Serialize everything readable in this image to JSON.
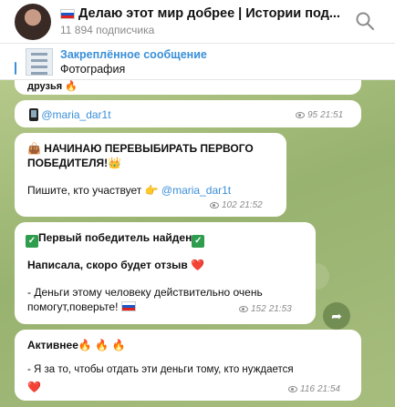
{
  "header": {
    "title": "Делаю этот мир добрее | Истории под...",
    "subscribers": "11 894 подписчика",
    "search_icon": "search-icon"
  },
  "pinned": {
    "label": "Закреплённое сообщение",
    "text": "Фотография"
  },
  "messages": {
    "top_fragment": "друзья 🔥",
    "m1": {
      "link": "@maria_dar1t",
      "views": "95",
      "time": "21:51"
    },
    "m2": {
      "line1": "👜 НАЧИНАЮ ПЕРЕВЫБИРАТЬ ПЕРВОГО",
      "line2": "ПОБЕДИТЕЛЯ!👑",
      "body": "Пишите, кто участвует 👉 ",
      "link": "@maria_dar1t",
      "views": "102",
      "time": "21:52"
    },
    "m3": {
      "headline": "Первый победитель найден",
      "line2": "Написала, скоро будет отзыв ❤️",
      "line3": "- Деньги этому человеку действительно очень",
      "line4": "помогут,поверьте! ",
      "views": "152",
      "time": "21:53"
    },
    "m4": {
      "headline": "Активнее🔥 🔥 🔥",
      "line2": "- Я за то, чтобы отдать эти деньги тому, кто нуждается",
      "line3": "❤️",
      "views": "116",
      "time": "21:54"
    }
  },
  "colors": {
    "accent": "#3a8fd8",
    "chat_bg": "#a7bd7e"
  }
}
